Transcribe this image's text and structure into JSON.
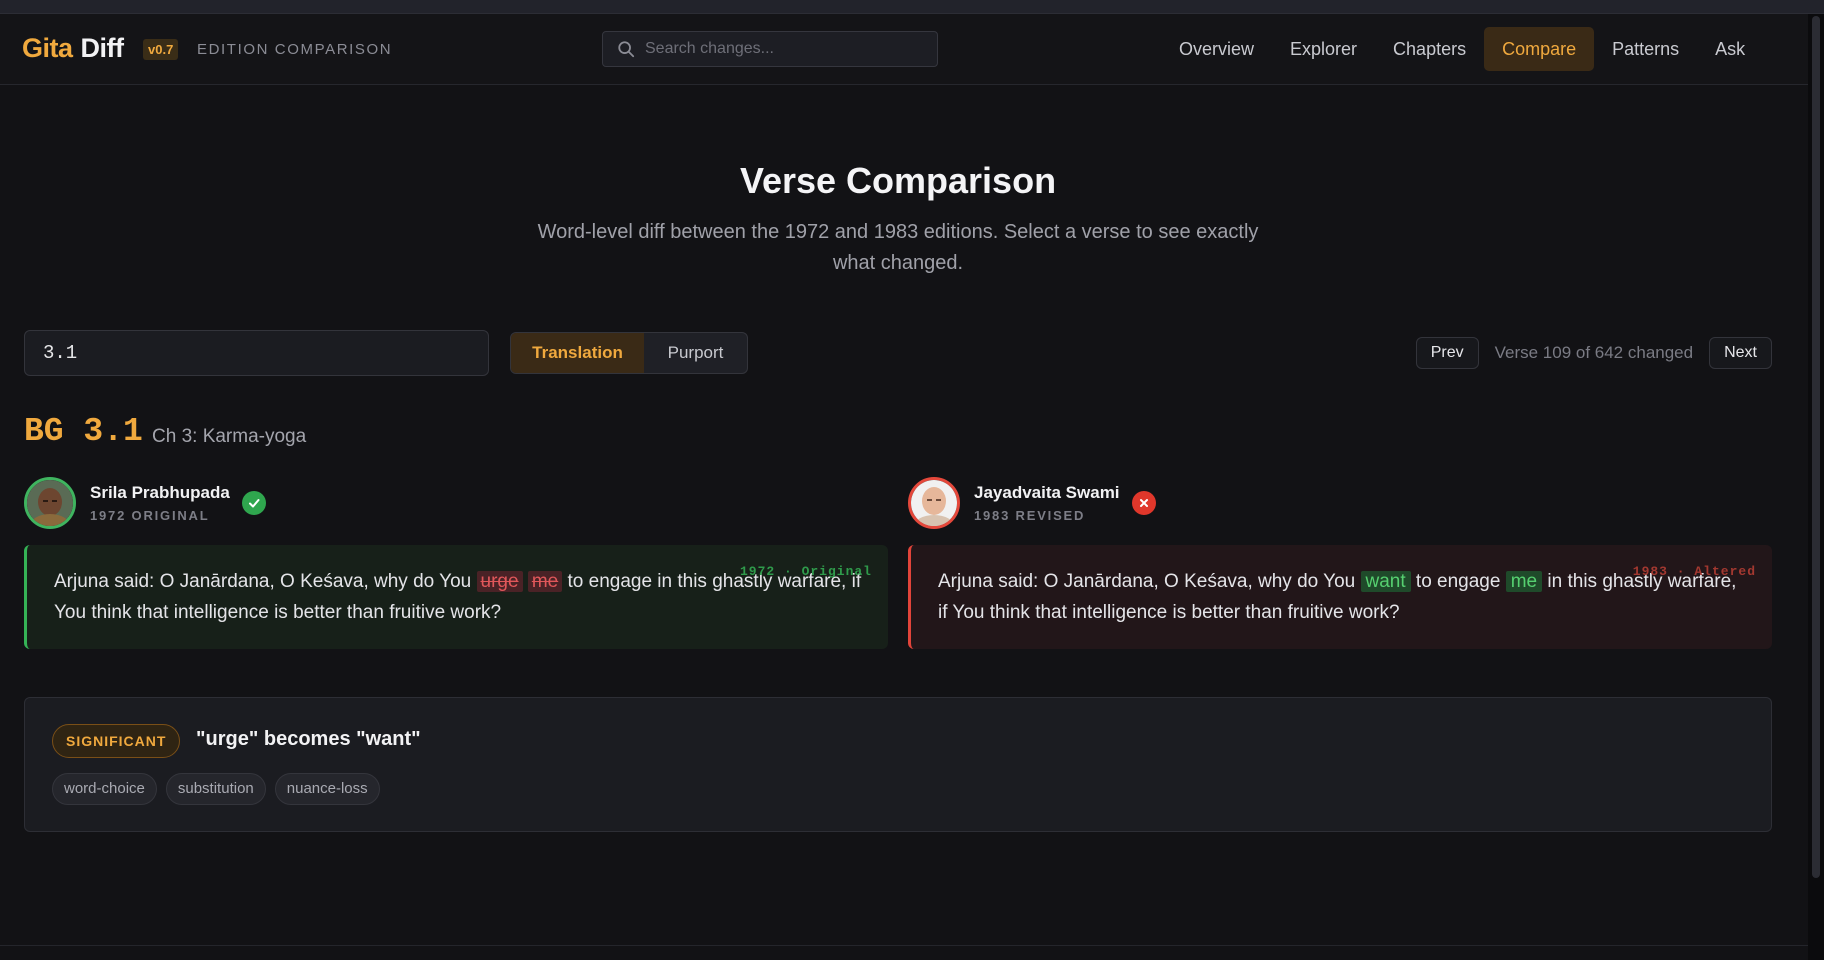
{
  "brand": {
    "part1": "Gita",
    "part2": "Diff",
    "version": "v0.7",
    "tagline": "EDITION COMPARISON"
  },
  "search": {
    "placeholder": "Search changes..."
  },
  "nav": {
    "items": [
      {
        "label": "Overview",
        "active": false
      },
      {
        "label": "Explorer",
        "active": false
      },
      {
        "label": "Chapters",
        "active": false
      },
      {
        "label": "Compare",
        "active": true
      },
      {
        "label": "Patterns",
        "active": false
      },
      {
        "label": "Ask",
        "active": false
      }
    ]
  },
  "hero": {
    "title": "Verse Comparison",
    "subtitle": "Word-level diff between the 1972 and 1983 editions. Select a verse to see exactly what changed."
  },
  "controls": {
    "verse_value": "3.1",
    "tabs": [
      "Translation",
      "Purport"
    ],
    "active_tab": "Translation",
    "prev_label": "Prev",
    "next_label": "Next",
    "status": "Verse 109 of 642 changed"
  },
  "verse": {
    "ref": "BG 3.1",
    "chapter": "Ch 3: Karma-yoga"
  },
  "original": {
    "name": "Srila Prabhupada",
    "edition": "1972 ORIGINAL",
    "tag": "1972 · Original",
    "text_before": "Arjuna said: O Janārdana, O Keśava, why do You ",
    "removed_1": "urge",
    "removed_2": "me",
    "text_after": " to engage in this ghastly warfare, if You think that intelligence is better than fruitive work?"
  },
  "revised": {
    "name": "Jayadvaita Swami",
    "edition": "1983 REVISED",
    "tag": "1983 · Altered",
    "text_before": "Arjuna said: O Janārdana, O Keśava, why do You ",
    "added_1": "want",
    "text_mid": " to engage ",
    "added_2": "me",
    "text_after": " in this ghastly warfare, if You think that intelligence is better than fruitive work?"
  },
  "change": {
    "severity": "SIGNIFICANT",
    "summary": "\"urge\" becomes \"want\"",
    "tags": [
      "word-choice",
      "substitution",
      "nuance-loss"
    ]
  },
  "colors": {
    "accent": "#f0a93e",
    "original": "#35b356",
    "altered": "#e2443a",
    "background": "#121215"
  }
}
